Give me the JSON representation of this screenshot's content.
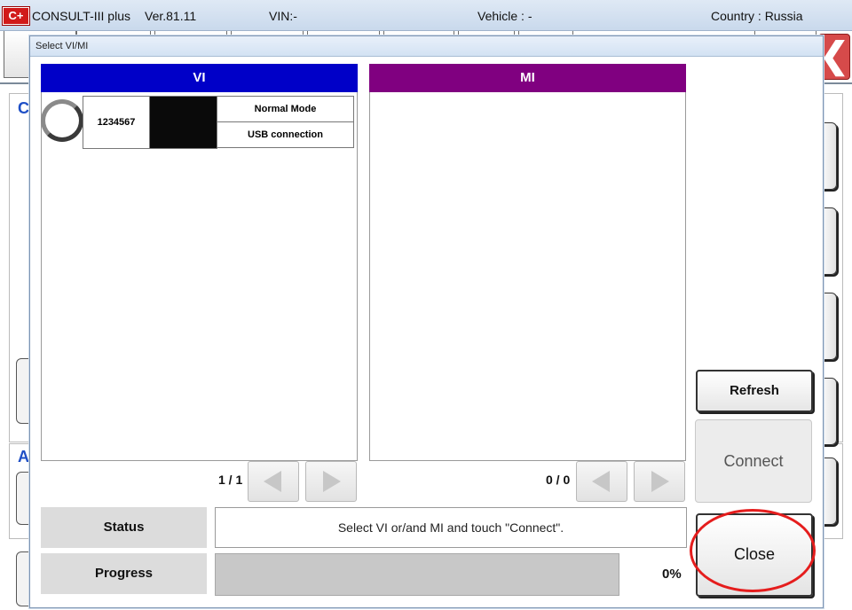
{
  "app": {
    "logo": "C+",
    "name": "CONSULT-III plus",
    "version": "Ver.81.11",
    "vin": "VIN:-",
    "vehicle": "Vehicle : -",
    "country": "Country : Russia",
    "close_glyph": "❮",
    "section_heading_1": "C",
    "section_heading_2": "A"
  },
  "dialog": {
    "title": "Select VI/MI",
    "vi": {
      "header": "VI",
      "header_color": "#0000c8",
      "items": [
        {
          "serial": "1234567",
          "mode": "Normal Mode",
          "connection": "USB connection"
        }
      ],
      "page": "1 / 1"
    },
    "mi": {
      "header": "MI",
      "header_color": "#800080",
      "page": "0 / 0"
    },
    "buttons": {
      "refresh": "Refresh",
      "connect": "Connect",
      "close": "Close"
    },
    "status": {
      "label": "Status",
      "message": "Select VI or/and MI and touch \"Connect\"."
    },
    "progress": {
      "label": "Progress",
      "value_percent": 0,
      "text": "0%"
    }
  }
}
